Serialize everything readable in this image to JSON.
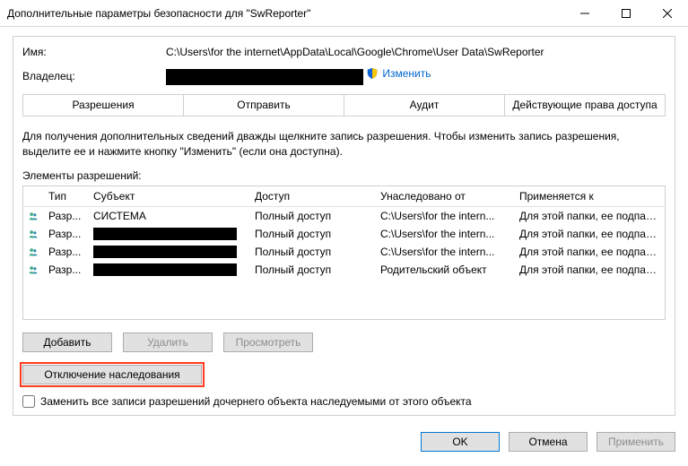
{
  "window": {
    "title": "Дополнительные параметры безопасности  для \"SwReporter\""
  },
  "fields": {
    "name_label": "Имя:",
    "name_value": "C:\\Users\\for the internet\\AppData\\Local\\Google\\Chrome\\User Data\\SwReporter",
    "owner_label": "Владелец:",
    "change_link": "Изменить"
  },
  "tabs": {
    "permissions": "Разрешения",
    "share": "Отправить",
    "audit": "Аудит",
    "effective": "Действующие права доступа"
  },
  "helptext": "Для получения дополнительных сведений дважды щелкните запись разрешения. Чтобы изменить запись разрешения, выделите ее и нажмите кнопку \"Изменить\" (если она доступна).",
  "section_label": "Элементы разрешений:",
  "columns": {
    "type": "Тип",
    "subject": "Субъект",
    "access": "Доступ",
    "inherited": "Унаследовано от",
    "applies": "Применяется к"
  },
  "rows": [
    {
      "type": "Разр...",
      "subject": "СИСТЕМА",
      "subject_redacted": false,
      "access": "Полный доступ",
      "inherited": "C:\\Users\\for the intern...",
      "applies": "Для этой папки, ее подпапок ..."
    },
    {
      "type": "Разр...",
      "subject": "",
      "subject_redacted": true,
      "access": "Полный доступ",
      "inherited": "C:\\Users\\for the intern...",
      "applies": "Для этой папки, ее подпапок ..."
    },
    {
      "type": "Разр...",
      "subject": "",
      "subject_redacted": true,
      "access": "Полный доступ",
      "inherited": "C:\\Users\\for the intern...",
      "applies": "Для этой папки, ее подпапок ..."
    },
    {
      "type": "Разр...",
      "subject": "",
      "subject_redacted": true,
      "access": "Полный доступ",
      "inherited": "Родительский объект",
      "applies": "Для этой папки, ее подпапок ..."
    }
  ],
  "buttons": {
    "add": "Добавить",
    "remove": "Удалить",
    "view": "Просмотреть",
    "disable_inherit": "Отключение наследования",
    "ok": "OK",
    "cancel": "Отмена",
    "apply": "Применить"
  },
  "checkbox_label": "Заменить все записи разрешений дочернего объекта наследуемыми от этого объекта"
}
